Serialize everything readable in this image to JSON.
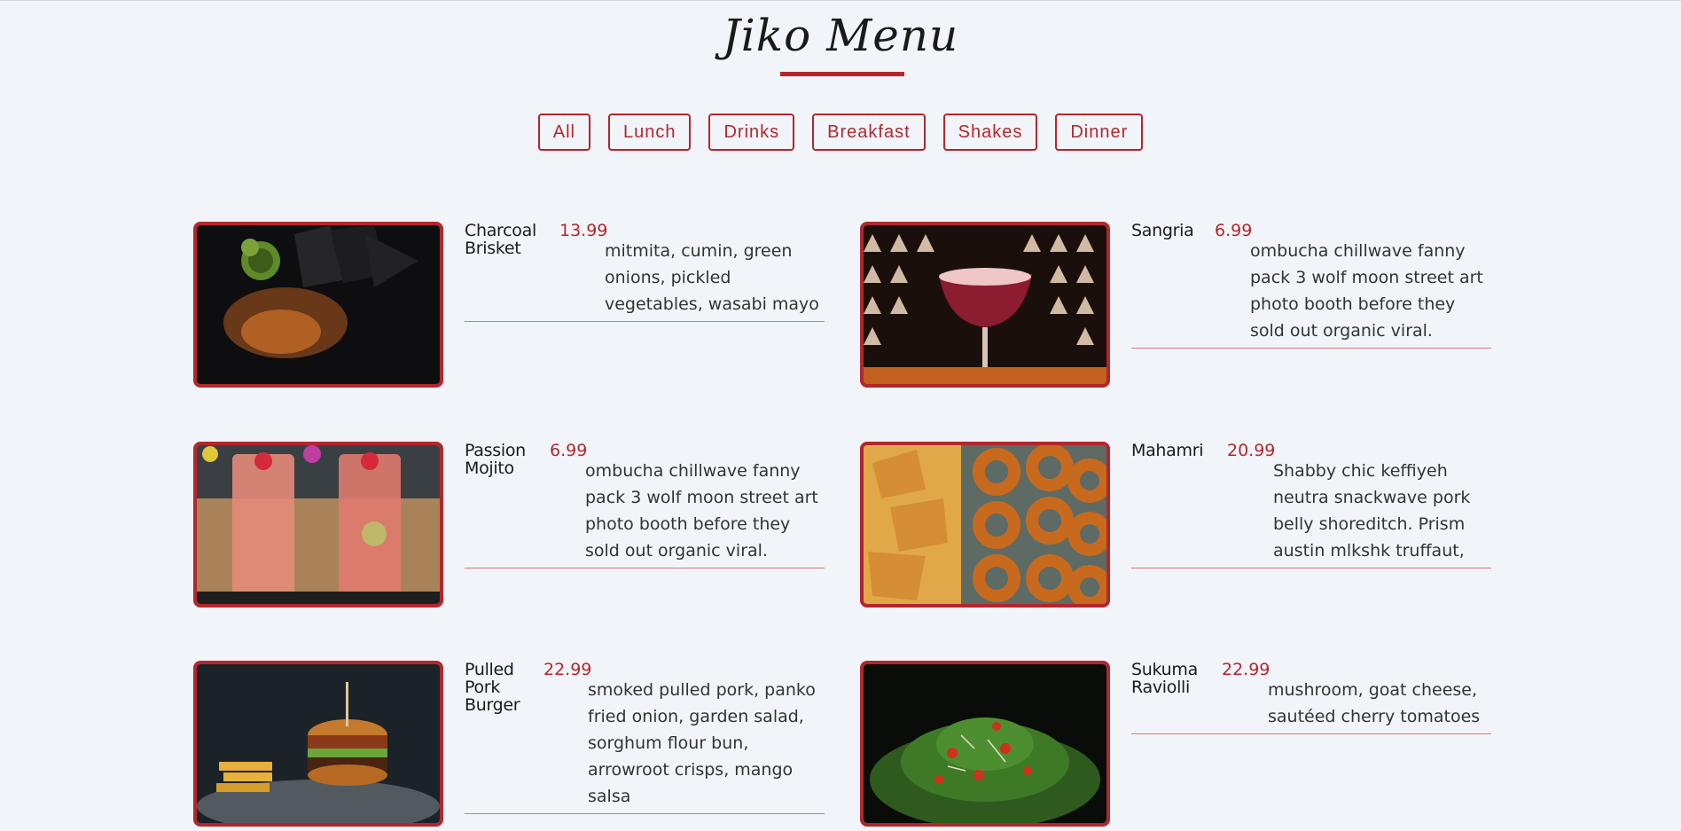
{
  "menu": {
    "title": "Jiko Menu"
  },
  "filters": [
    "All",
    "Lunch",
    "Drinks",
    "Breakfast",
    "Shakes",
    "Dinner"
  ],
  "items": [
    {
      "name": "Charcoal Brisket",
      "price": "13.99",
      "desc": "mitmita, cumin, green onions, pickled vegetables, wasabi mayo",
      "image": "charcoal-brisket-photo"
    },
    {
      "name": "Sangria",
      "price": "6.99",
      "desc": "ombucha chillwave fanny pack 3 wolf moon street art photo booth before they sold out organic viral.",
      "image": "sangria-photo"
    },
    {
      "name": "Passion Mojito",
      "price": "6.99",
      "desc": "ombucha chillwave fanny pack 3 wolf moon street art photo booth before they sold out organic viral.",
      "image": "passion-mojito-photo"
    },
    {
      "name": "Mahamri",
      "price": "20.99",
      "desc": "Shabby chic keffiyeh neutra snackwave pork belly shoreditch. Prism austin mlkshk truffaut,",
      "image": "mahamri-photo"
    },
    {
      "name": "Pulled Pork Burger",
      "price": "22.99",
      "desc": "smoked pulled pork, panko fried onion, garden salad, sorghum flour bun, arrowroot crisps, mango salsa",
      "image": "pulled-pork-burger-photo"
    },
    {
      "name": "Sukuma Raviolli",
      "price": "22.99",
      "desc": "mushroom, goat cheese, sautéed cherry tomatoes",
      "image": "sukuma-raviolli-photo"
    }
  ],
  "colors": {
    "accent": "#b3262d",
    "background": "#f1f4f8"
  }
}
